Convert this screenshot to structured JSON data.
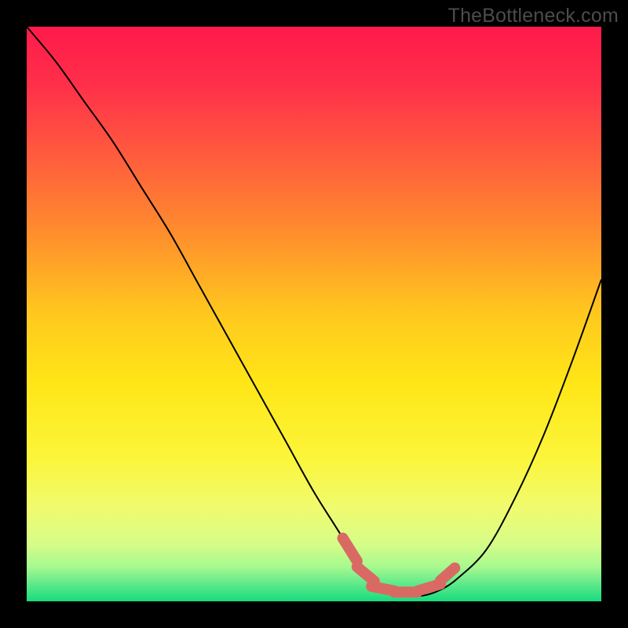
{
  "watermark": "TheBottleneck.com",
  "colors": {
    "background": "#000000",
    "gradient_stops": [
      {
        "offset": 0.0,
        "color": "#ff1a4b"
      },
      {
        "offset": 0.1,
        "color": "#ff2f4a"
      },
      {
        "offset": 0.22,
        "color": "#ff5a3e"
      },
      {
        "offset": 0.35,
        "color": "#ff8a2e"
      },
      {
        "offset": 0.5,
        "color": "#ffc81e"
      },
      {
        "offset": 0.62,
        "color": "#ffe617"
      },
      {
        "offset": 0.75,
        "color": "#fbf53a"
      },
      {
        "offset": 0.84,
        "color": "#f0fb70"
      },
      {
        "offset": 0.9,
        "color": "#d6fc88"
      },
      {
        "offset": 0.94,
        "color": "#a7f98f"
      },
      {
        "offset": 0.97,
        "color": "#5ee98a"
      },
      {
        "offset": 1.0,
        "color": "#18db7e"
      }
    ],
    "curve": "#000000",
    "marker_fill": "#d96a63",
    "marker_stroke": "#b84f49"
  },
  "chart_data": {
    "type": "line",
    "title": "",
    "xlabel": "",
    "ylabel": "",
    "xlim": [
      0,
      100
    ],
    "ylim": [
      0,
      100
    ],
    "series": [
      {
        "name": "bottleneck-curve",
        "x": [
          0,
          5,
          10,
          15,
          20,
          25,
          30,
          35,
          40,
          45,
          50,
          55,
          57,
          60,
          63,
          66,
          69,
          72,
          75,
          80,
          85,
          90,
          95,
          100
        ],
        "y": [
          100,
          94,
          87,
          80,
          72,
          64,
          55,
          46,
          37,
          28,
          19,
          11,
          7,
          4,
          2,
          1,
          1,
          2,
          4,
          9,
          18,
          29,
          42,
          56
        ]
      }
    ],
    "markers": {
      "name": "flat-bottom-segments",
      "segments": [
        {
          "x0": 55.0,
          "y0": 11.0,
          "x1": 57.5,
          "y1": 7.0
        },
        {
          "x0": 57.5,
          "y0": 6.0,
          "x1": 60.5,
          "y1": 3.5
        },
        {
          "x0": 60.0,
          "y0": 2.6,
          "x1": 64.0,
          "y1": 1.8
        },
        {
          "x0": 64.0,
          "y0": 1.6,
          "x1": 68.0,
          "y1": 1.6
        },
        {
          "x0": 68.0,
          "y0": 1.8,
          "x1": 72.0,
          "y1": 3.0
        },
        {
          "x0": 72.0,
          "y0": 3.6,
          "x1": 74.5,
          "y1": 5.8
        }
      ]
    }
  }
}
